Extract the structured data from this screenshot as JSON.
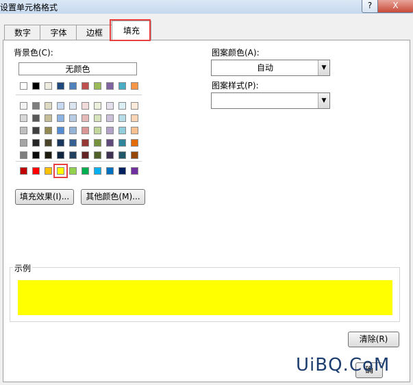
{
  "window": {
    "title": "设置单元格格式",
    "help": "?",
    "close": "X"
  },
  "tabs": [
    {
      "label": "数字"
    },
    {
      "label": "字体"
    },
    {
      "label": "边框"
    },
    {
      "label": "填充",
      "active": true
    }
  ],
  "fill": {
    "background_label": "背景色(C):",
    "no_color": "无颜色",
    "theme_top": [
      "#ffffff",
      "#000000",
      "#eeece1",
      "#1f497d",
      "#4f81bd",
      "#c0504d",
      "#9bbb59",
      "#8064a2",
      "#4bacc6",
      "#f79646"
    ],
    "theme_shades": [
      [
        "#f2f2f2",
        "#7f7f7f",
        "#ddd9c3",
        "#c6d9f0",
        "#dbe5f1",
        "#f2dcdb",
        "#ebf1dd",
        "#e5e0ec",
        "#dbeef3",
        "#fdeada"
      ],
      [
        "#d8d8d8",
        "#595959",
        "#c4bd97",
        "#8db3e2",
        "#b8cce4",
        "#e5b9b7",
        "#d7e3bc",
        "#ccc1d9",
        "#b7dde8",
        "#fbd5b5"
      ],
      [
        "#bfbfbf",
        "#3f3f3f",
        "#938953",
        "#548dd4",
        "#95b3d7",
        "#d99694",
        "#c3d69b",
        "#b2a2c7",
        "#92cddc",
        "#fac08f"
      ],
      [
        "#a5a5a5",
        "#262626",
        "#494429",
        "#17365d",
        "#366092",
        "#953734",
        "#76923c",
        "#5f497a",
        "#31859b",
        "#e36c09"
      ],
      [
        "#7f7f7f",
        "#0c0c0c",
        "#1d1b10",
        "#0f243e",
        "#244061",
        "#632423",
        "#4f6128",
        "#3f3151",
        "#205867",
        "#974806"
      ]
    ],
    "standard": [
      "#c00000",
      "#ff0000",
      "#ffc000",
      "#ffff00",
      "#92d050",
      "#00b050",
      "#00b0f0",
      "#0070c0",
      "#002060",
      "#7030a0"
    ],
    "selected_standard_index": 3,
    "fill_effects_button": "填充效果(I)...",
    "more_colors_button": "其他颜色(M)...",
    "pattern_color_label": "图案颜色(A):",
    "pattern_color_value": "自动",
    "pattern_style_label": "图案样式(P):",
    "pattern_style_value": "",
    "sample_label": "示例",
    "sample_color": "#ffff00",
    "clear_button": "清除(R)",
    "apply_button_partial": "确"
  },
  "watermark": "UiBQ.CoM"
}
